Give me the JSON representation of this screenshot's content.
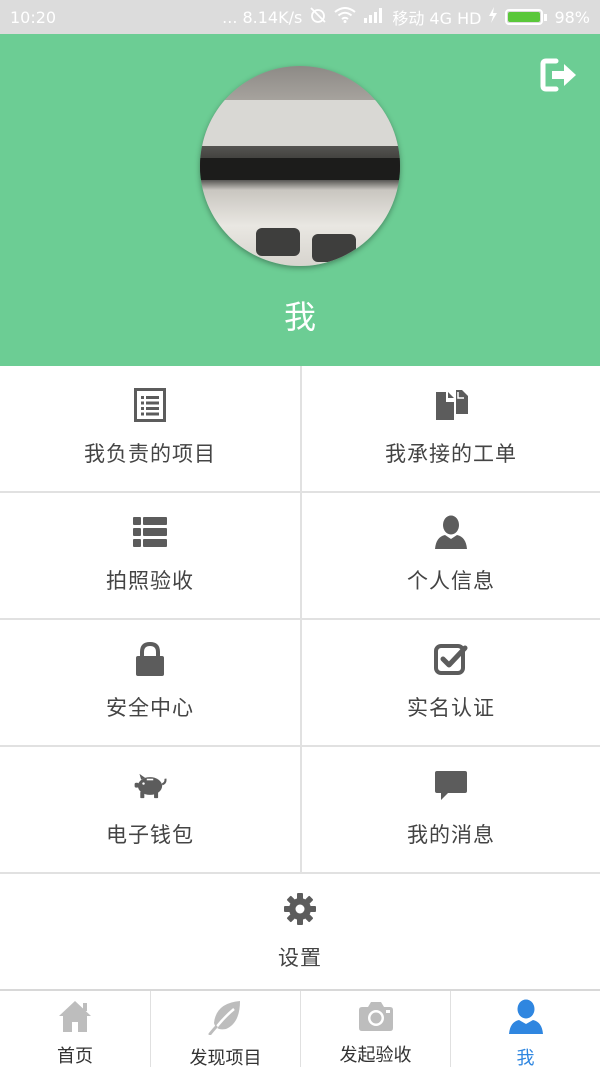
{
  "status_bar": {
    "time": "10:20",
    "network_speed": "... 8.14K/s",
    "carrier": "移动 4G HD",
    "battery": "98%",
    "battery_level": 0.98
  },
  "profile": {
    "name": "我",
    "logout_icon": "logout-icon"
  },
  "menu": [
    {
      "label": "我负责的项目",
      "icon": "list-document-icon"
    },
    {
      "label": "我承接的工单",
      "icon": "files-icon"
    },
    {
      "label": "拍照验收",
      "icon": "list-icon"
    },
    {
      "label": "个人信息",
      "icon": "user-icon"
    },
    {
      "label": "安全中心",
      "icon": "lock-icon"
    },
    {
      "label": "实名认证",
      "icon": "check-square-icon"
    },
    {
      "label": "电子钱包",
      "icon": "piggy-bank-icon"
    },
    {
      "label": "我的消息",
      "icon": "message-icon"
    },
    {
      "label": "设置",
      "icon": "gear-icon"
    }
  ],
  "nav": {
    "active_color": "#2f86e0",
    "items": [
      {
        "label": "首页",
        "icon": "home-icon"
      },
      {
        "label": "发现项目",
        "icon": "leaf-icon"
      },
      {
        "label": "发起验收",
        "icon": "camera-icon"
      },
      {
        "label": "我",
        "icon": "user-icon"
      }
    ]
  },
  "colors": {
    "header_bg": "#6ccd94",
    "icon_gray": "#5c5c5c"
  }
}
